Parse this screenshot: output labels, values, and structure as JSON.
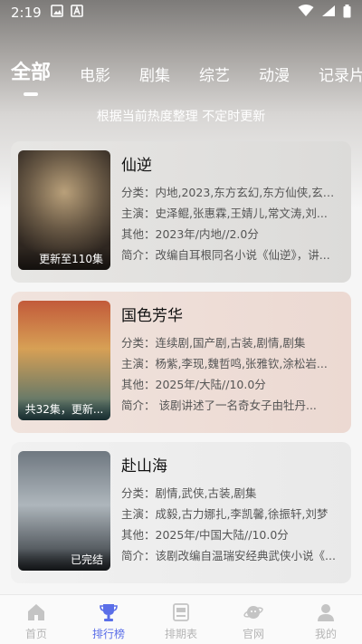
{
  "status_bar": {
    "time": "2:19"
  },
  "tabs": [
    {
      "label": "全部",
      "active": true
    },
    {
      "label": "电影"
    },
    {
      "label": "剧集"
    },
    {
      "label": "综艺"
    },
    {
      "label": "动漫"
    },
    {
      "label": "记录片"
    }
  ],
  "subtitle": "根据当前热度整理 不定时更新",
  "items": [
    {
      "title": "仙逆",
      "episode_badge": "更新至110集",
      "category": "分类：内地,2023,东方玄幻,东方仙侠,玄幻...",
      "cast": "主演：史泽鲲,张惠霖,王婧儿,常文涛,刘...",
      "other": "其他：2023年/内地//2.0分",
      "intro": "简介：改编自耳根同名小说《仙逆》，讲..."
    },
    {
      "title": "国色芳华",
      "episode_badge": "共32集，更新...",
      "category": "分类：连续剧,国产剧,古装,剧情,剧集",
      "cast": "主演：杨紫,李现,魏哲鸣,张雅钦,涂松岩...",
      "other": "其他：2025年/大陆//10.0分",
      "intro": "简介：        该剧讲述了一名奇女子由牡丹..."
    },
    {
      "title": "赴山海",
      "episode_badge": "已完结",
      "category": "分类：剧情,武侠,古装,剧集",
      "cast": "主演：成毅,古力娜扎,李凯馨,徐振轩,刘梦",
      "other": "其他：2025年/中国大陆//10.0分",
      "intro": "简介：该剧改编自温瑞安经典武侠小说《..."
    }
  ],
  "bottom_nav": [
    {
      "label": "首页",
      "icon": "home-icon"
    },
    {
      "label": "排行榜",
      "icon": "trophy-icon",
      "active": true
    },
    {
      "label": "排期表",
      "icon": "schedule-icon"
    },
    {
      "label": "官网",
      "icon": "planet-icon"
    },
    {
      "label": "我的",
      "icon": "user-icon"
    }
  ],
  "colors": {
    "accent": "#5a6ee8",
    "inactive_nav": "#b5b5b5"
  }
}
